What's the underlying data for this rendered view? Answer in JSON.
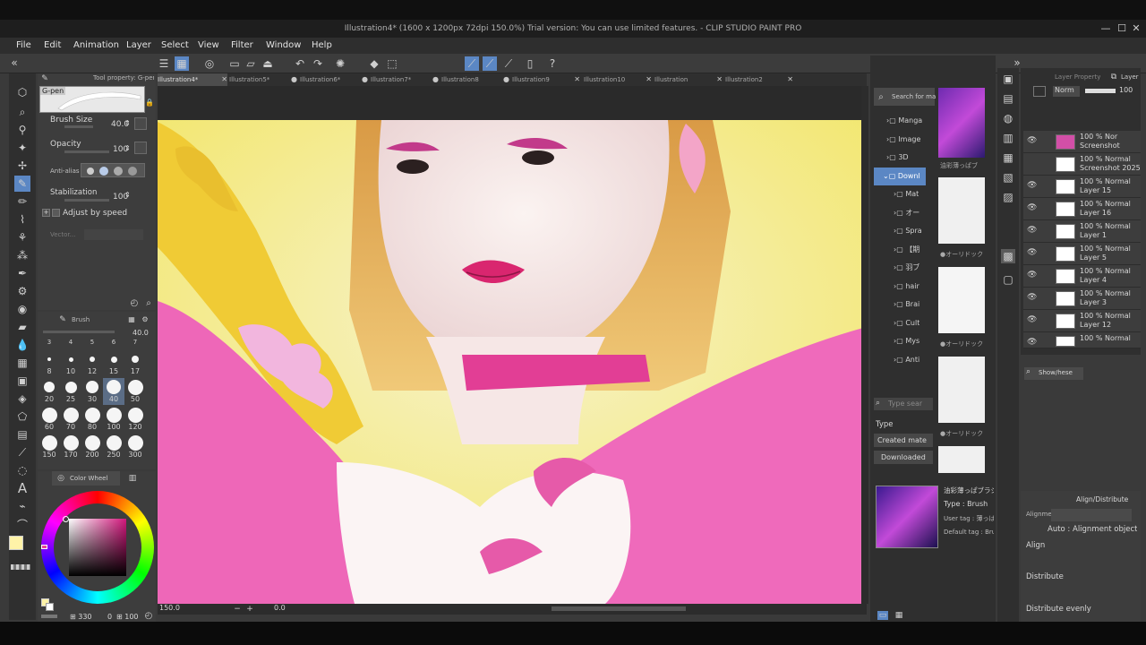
{
  "window": {
    "title": "Illustration4* (1600 x 1200px 72dpi 150.0%)  Trial version: You can use limited features. - CLIP STUDIO PAINT PRO",
    "minimize": "—",
    "maximize": "☐",
    "close": "✕"
  },
  "menu": [
    "File",
    "Edit",
    "Animation",
    "Layer",
    "Select",
    "View",
    "Filter",
    "Window",
    "Help"
  ],
  "tabs": [
    {
      "label": "Illustration4*",
      "active": true
    },
    {
      "label": "Illustration5*"
    },
    {
      "label": "Illustration6*"
    },
    {
      "label": "Illustration7*"
    },
    {
      "label": "Illustration8"
    },
    {
      "label": "Illustration9"
    },
    {
      "label": "Illustration10"
    },
    {
      "label": "Illustration"
    },
    {
      "label": "Illustration2"
    }
  ],
  "tool_property": {
    "header": "Tool property: G-pen",
    "brush_name": "G-pen",
    "brush_size_label": "Brush Size",
    "brush_size_value": "40.0",
    "opacity_label": "Opacity",
    "opacity_value": "100",
    "antialias_label": "Anti-alias",
    "stabilization_label": "Stabilization",
    "stabilization_value": "100",
    "adjust_speed_label": "Adjust by speed",
    "vector_label": "Vector..."
  },
  "brush_size_panel": {
    "header": "Brush",
    "slider_value": "40.0",
    "top_row": [
      "3",
      "4",
      "5",
      "6",
      "7"
    ],
    "sizes": [
      "8",
      "10",
      "12",
      "15",
      "17",
      "20",
      "25",
      "30",
      "40",
      "50",
      "60",
      "70",
      "80",
      "100",
      "120",
      "150",
      "170",
      "200",
      "250",
      "300"
    ],
    "selected": "40"
  },
  "color_panel": {
    "header": "Color Wheel",
    "status": "330",
    "status2": "0",
    "status3": "100",
    "main_color": "#fff3a8",
    "sub_color": "#ffffff"
  },
  "status_bar": {
    "zoom": "150.0",
    "angle": "0.0"
  },
  "material_panel": {
    "search_label": "Search for ma",
    "tree": [
      "Manga",
      "Image",
      "3D",
      "Downl",
      "Mat",
      "オー",
      "Spra",
      "【期",
      "羽ブ",
      "hair",
      "Brai",
      "Cult",
      "Mys",
      "Anti"
    ],
    "search_placeholder": "Type sear",
    "type_label": "Type",
    "filters": [
      "Created mate",
      "Downloaded"
    ],
    "thumb_labels": [
      "油彩薄っぱブ",
      "●オーリドック",
      "●オーリドック",
      "●オーリドック"
    ],
    "detail_title": "油彩薄っぱブラシ",
    "detail_type": "Type : Brush",
    "detail_usertag": "User tag : 薄っぱ",
    "detail_default": "Default tag : Brus"
  },
  "layer_panel": {
    "header": "Layer Property",
    "header2": "Layer",
    "blend": "Norm",
    "opacity": "100",
    "layers": [
      {
        "line1": "100 % Nor",
        "line2": "Screenshot"
      },
      {
        "line1": "100 % Normal",
        "line2": "Screenshot 2025"
      },
      {
        "line1": "100 % Normal",
        "line2": "Layer 15"
      },
      {
        "line1": "100 % Normal",
        "line2": "Layer 16"
      },
      {
        "line1": "100 % Normal",
        "line2": "Layer 1"
      },
      {
        "line1": "100 % Normal",
        "line2": "Layer 5"
      },
      {
        "line1": "100 % Normal",
        "line2": "Layer 4"
      },
      {
        "line1": "100 % Normal",
        "line2": "Layer 3"
      },
      {
        "line1": "100 % Normal",
        "line2": "Layer 12"
      },
      {
        "line1": "100 % Normal",
        "line2": ""
      }
    ],
    "search_label": "Show/hese"
  },
  "align_panel": {
    "header": "Align/Distribute",
    "align_label": "Alignme",
    "align_target": "Auto : Alignment object",
    "align": "Align",
    "distribute": "Distribute",
    "distribute_evenly": "Distribute evenly"
  },
  "colors": {
    "accent": "#5b87c4",
    "pink": "#e8409a",
    "yellow": "#f1d93a"
  }
}
